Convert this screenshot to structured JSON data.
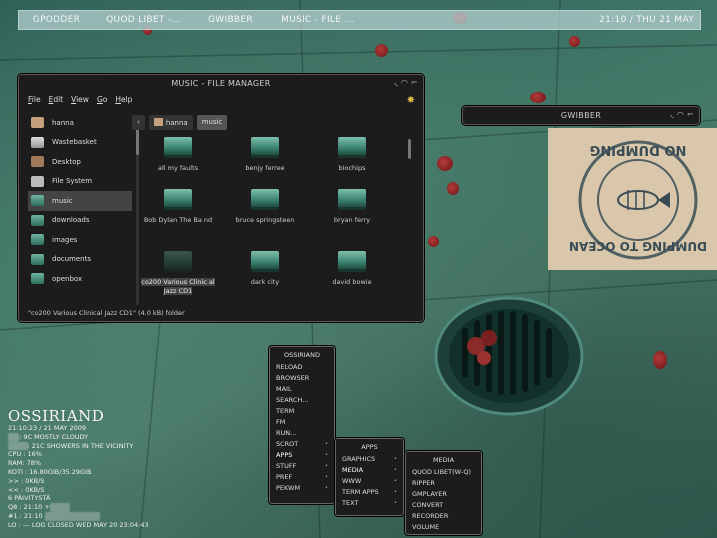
{
  "taskbar": {
    "tasks": [
      "GPODDER",
      "QUOD LIBET -...",
      "GWIBBER",
      "MUSIC - FILE ..."
    ],
    "clock": "21:10 / THU 21 MAY"
  },
  "file_manager": {
    "title": "MUSIC - FILE MANAGER",
    "controls": "◟ ◠ ⌐",
    "menu": [
      "File",
      "Edit",
      "View",
      "Go",
      "Help"
    ],
    "places": [
      {
        "label": "hanna",
        "icon": "home-icon"
      },
      {
        "label": "Wastebasket",
        "icon": "trash-icon"
      },
      {
        "label": "Desktop",
        "icon": "desktop-icon"
      },
      {
        "label": "File System",
        "icon": "drive-icon"
      },
      {
        "label": "music",
        "icon": "folder-icon",
        "selected": true
      },
      {
        "label": "downloads",
        "icon": "folder-icon"
      },
      {
        "label": "images",
        "icon": "folder-icon"
      },
      {
        "label": "documents",
        "icon": "folder-icon"
      },
      {
        "label": "openbox",
        "icon": "folder-icon"
      }
    ],
    "path": {
      "back": "‹",
      "home": "hanna",
      "current": "music"
    },
    "files": [
      "all my faults",
      "benjy ferree",
      "biochips",
      "Bob Dylan    The Ba nd",
      "bruce springsteen",
      "bryan ferry",
      "co200 Various   Clinic al Jazz CD1",
      "dark city",
      "david bowie"
    ],
    "selected_file_index": 6,
    "status": "\"co200 Various   Clinical Jazz CD1\" (4.0 kB) folder"
  },
  "gwibber": {
    "title": "GWIBBER",
    "controls": "◟ ◠ ⌐"
  },
  "menus": {
    "root": {
      "title": "OSSIRIAND",
      "items": [
        {
          "label": "RELOAD"
        },
        {
          "label": "BROWSER"
        },
        {
          "label": "MAIL"
        },
        {
          "label": "SEARCH..."
        },
        {
          "label": "TERM"
        },
        {
          "label": "FM"
        },
        {
          "label": "RUN..."
        },
        {
          "label": "SCROT",
          "arrow": "•"
        },
        {
          "label": "APPS",
          "arrow": "•"
        },
        {
          "label": "STUFF",
          "arrow": "•"
        },
        {
          "label": "PREF",
          "arrow": "•"
        },
        {
          "label": "PEKWM",
          "arrow": "•"
        }
      ]
    },
    "apps": {
      "title": "APPS",
      "items": [
        {
          "label": "GRAPHICS",
          "arrow": "•"
        },
        {
          "label": "MEDIA",
          "arrow": "•"
        },
        {
          "label": "WWW",
          "arrow": "•"
        },
        {
          "label": "TERM APPS",
          "arrow": "•"
        },
        {
          "label": "TEXT",
          "arrow": "•"
        }
      ]
    },
    "media": {
      "title": "MEDIA",
      "items": [
        {
          "label": "QUOD LIBET(W-Q)"
        },
        {
          "label": "RIPPER"
        },
        {
          "label": "GMPLAYER"
        },
        {
          "label": "CONVERT"
        },
        {
          "label": "RECORDER"
        },
        {
          "label": "VOLUME"
        }
      ]
    }
  },
  "conky": {
    "host": "OSSIRIAND",
    "datetime": "21:10:23 / 21 MAY 2009",
    "weather1": ": 9C MOSTLY CLOUDY",
    "weather2": ": 21C SHOWERS IN THE VICINITY",
    "cpu": "CPU : 16%",
    "ram": "RAM: 78%",
    "koti": "KOTI : 16.80GIB/35.29GIB",
    "up": ">> : 0KB/S",
    "down": "<< : 0KB/S",
    "days": "6 PÄIVITYSTÄ",
    "q8": "Q8 : 21:10 +",
    "num1": "#1 : 21:10",
    "log": "LO : --- LOG CLOSED WED MAY 20 23:04:43"
  },
  "stamp": {
    "text_top": "DUMPING TO OCEAN",
    "text_bottom": "NO DUMPING"
  },
  "colors": {
    "window_bg": "#1c1c1c",
    "taskbar_bg": "#afcdcd",
    "accent_folder": "#3c8470",
    "petal": "#b43b3b"
  }
}
